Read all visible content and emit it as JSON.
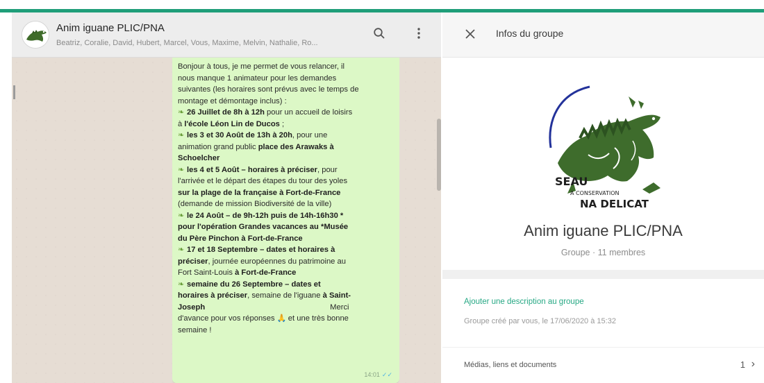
{
  "colors": {
    "accent": "#1f9e79",
    "bubble": "#dcf8c6",
    "link": "#26a884"
  },
  "chat": {
    "title": "Anim iguane PLIC/PNA",
    "members": "Beatriz, Coralie, David, Hubert, Marcel, Vous, Maxime, Melvin, Nathalie, Ro...",
    "avatar_icon": "iguana-avatar-icon",
    "search_icon": "search-icon",
    "menu_icon": "vertical-dots-icon"
  },
  "message": {
    "lines": [
      [
        {
          "t": "Bonjour à tous, je me permet de vous relancer, il"
        }
      ],
      [
        {
          "t": "nous manque 1 animateur pour les demandes"
        }
      ],
      [
        {
          "t": "suivantes (les horaires sont prévus avec le temps de"
        }
      ],
      [
        {
          "t": "montage et démontage inclus) :"
        }
      ],
      [
        {
          "e": "leaf-emoji"
        },
        {
          "t": "26 Juillet de 8h à 12h",
          "b": true
        },
        {
          "t": " pour un accueil de loisirs"
        }
      ],
      [
        {
          "t": "à "
        },
        {
          "t": "l'école Léon Lin de Ducos",
          "b": true
        },
        {
          "t": " ;"
        }
      ],
      [
        {
          "e": "leaf-emoji"
        },
        {
          "t": "les 3 et 30 Août de 13h à 20h",
          "b": true
        },
        {
          "t": ", pour une"
        }
      ],
      [
        {
          "t": "animation grand public "
        },
        {
          "t": "place des Arawaks à",
          "b": true
        }
      ],
      [
        {
          "t": "Schoelcher",
          "b": true
        }
      ],
      [
        {
          "e": "leaf-emoji"
        },
        {
          "t": "les 4 et 5 Août – horaires à préciser",
          "b": true
        },
        {
          "t": ", pour"
        }
      ],
      [
        {
          "t": "l'arrivée et le départ des étapes du tour des yoles"
        }
      ],
      [
        {
          "t": "sur la plage de la française à Fort-de-France",
          "b": true
        }
      ],
      [
        {
          "t": "(demande de mission Biodiversité de la ville)"
        }
      ],
      [
        {
          "e": "leaf-emoji"
        },
        {
          "t": "le 24 Août – de 9h-12h puis de 14h-16h30 *",
          "b": true
        }
      ],
      [
        {
          "t": "pour l'opération Grandes vacances au *Musée",
          "b": true
        }
      ],
      [
        {
          "t": "du Père Pinchon à Fort-de-France",
          "b": true
        }
      ],
      [
        {
          "e": "leaf-emoji"
        },
        {
          "t": "17 et 18 Septembre – dates et horaires à",
          "b": true
        }
      ],
      [
        {
          "t": "préciser",
          "b": true
        },
        {
          "t": ", journée européennes du patrimoine au"
        }
      ],
      [
        {
          "t": "Fort Saint-Louis "
        },
        {
          "t": "à Fort-de-France",
          "b": true
        }
      ],
      [
        {
          "e": "leaf-emoji"
        },
        {
          "t": "semaine du 26 Septembre – dates et",
          "b": true
        }
      ],
      [
        {
          "t": "horaires à préciser",
          "b": true
        },
        {
          "t": ", semaine de l'iguane "
        },
        {
          "t": "à Saint-",
          "b": true
        }
      ],
      [
        {
          "t": "Joseph",
          "b": true
        },
        {
          "sp": true
        },
        {
          "t": "Merci"
        }
      ],
      [
        {
          "t": "d'avance pour vos réponses "
        },
        {
          "e": "praying-hands-emoji"
        },
        {
          "t": " et une très bonne"
        }
      ],
      [
        {
          "t": "semaine !"
        }
      ]
    ],
    "time": "14:01",
    "status_icon": "double-check-icon"
  },
  "info": {
    "header_title": "Infos du groupe",
    "close_icon": "close-icon",
    "group_name": "Anim iguane PLIC/PNA",
    "group_subtitle": "Groupe · 11 membres",
    "logo_text": [
      "SEAU",
      "A CONSERVATION",
      "NA DELICAT"
    ],
    "add_description": "Ajouter une description au groupe",
    "created_by": "Groupe créé par vous, le 17/06/2020 à 15:32",
    "media_label": "Médias, liens et documents",
    "media_count": "1",
    "chevron_icon": "chevron-right-icon"
  }
}
